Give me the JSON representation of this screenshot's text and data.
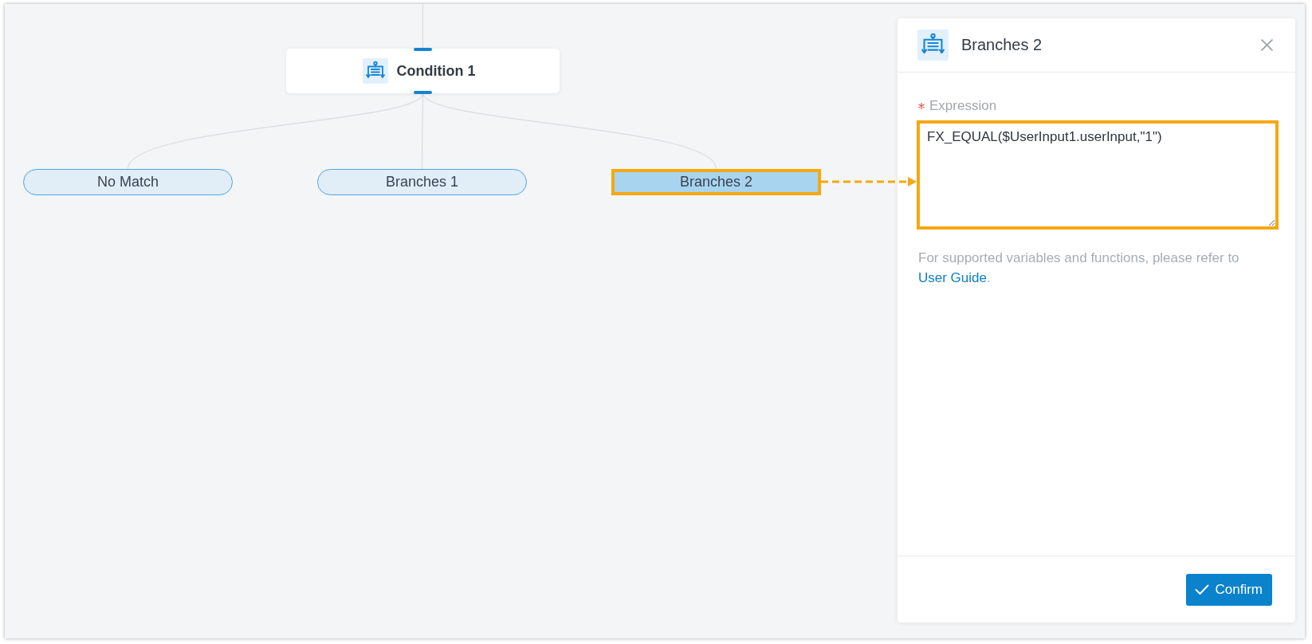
{
  "canvas": {
    "condition_node": {
      "title": "Condition 1"
    },
    "branches": [
      {
        "label": "No Match",
        "selected": false
      },
      {
        "label": "Branches 1",
        "selected": false
      },
      {
        "label": "Branches 2",
        "selected": true
      }
    ]
  },
  "panel": {
    "title": "Branches 2",
    "expression": {
      "label": "Expression",
      "required": true,
      "value": "FX_EQUAL($UserInput1.userInput,\"1\")",
      "highlighted": true
    },
    "help": {
      "text": "For supported variables and functions, please refer to",
      "link": "User Guide",
      "suffix": "."
    },
    "buttons": [
      {
        "label": "Confirm",
        "kind": "primary"
      }
    ]
  }
}
